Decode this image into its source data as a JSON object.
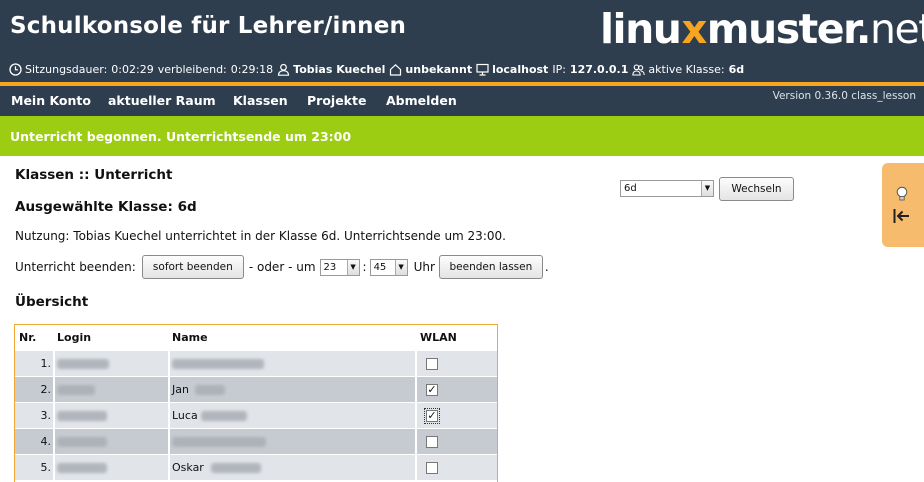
{
  "header": {
    "title": "Schulkonsole für Lehrer/innen",
    "logo": {
      "part1": "linu",
      "x": "x",
      "part2": "muster",
      "dot": ".",
      "part3": "net"
    }
  },
  "status": {
    "session_label": "Sitzungsdauer:",
    "session_value": "0:02:29",
    "remaining_label": "verbleibend:",
    "remaining_value": "0:29:18",
    "user": "Tobias Kuechel",
    "room": "unbekannt",
    "host": "localhost",
    "ip_label": "IP:",
    "ip": "127.0.0.1",
    "class_label": "aktive Klasse:",
    "class_value": "6d"
  },
  "menu": {
    "items": [
      "Mein Konto",
      "aktueller Raum",
      "Klassen",
      "Projekte",
      "Abmelden"
    ],
    "version": "Version 0.36.0 class_lesson"
  },
  "banner": "Unterricht begonnen. Unterrichtsende um 23:00",
  "main": {
    "heading": "Klassen :: Unterricht",
    "selected_class_heading": "Ausgewählte Klasse: 6d",
    "usage": "Nutzung: Tobias Kuechel unterrichtet in der Klasse 6d. Unterrichtsende um 23:00.",
    "class_select_value": "6d",
    "switch_button": "Wechseln",
    "end_label": "Unterricht beenden:",
    "end_now_button": "sofort beenden",
    "or_label": "- oder - um",
    "hour_value": "23",
    "colon": ":",
    "minute_value": "45",
    "uhr_label": "Uhr",
    "end_later_button": "beenden lassen",
    "period": ".",
    "overview_heading": "Übersicht"
  },
  "table": {
    "headers": {
      "nr": "Nr.",
      "login": "Login",
      "name": "Name",
      "wlan": "WLAN"
    },
    "rows": [
      {
        "nr": "1.",
        "first_name": "",
        "wlan": false
      },
      {
        "nr": "2.",
        "first_name": "Jan",
        "wlan": true
      },
      {
        "nr": "3.",
        "first_name": "Luca",
        "wlan": true
      },
      {
        "nr": "4.",
        "first_name": "",
        "wlan": false
      },
      {
        "nr": "5.",
        "first_name": "Oskar",
        "wlan": false
      }
    ]
  },
  "colors": {
    "header_bg": "#2e3e4e",
    "accent": "#f7a520",
    "banner_bg": "#9ccd12",
    "row_light": "#e1e4e8",
    "row_dark": "#c6cbd1"
  },
  "icons": [
    "clock-icon",
    "user-icon",
    "home-icon",
    "monitor-icon",
    "users-icon",
    "lightbulb-icon",
    "collapse-left-icon"
  ]
}
